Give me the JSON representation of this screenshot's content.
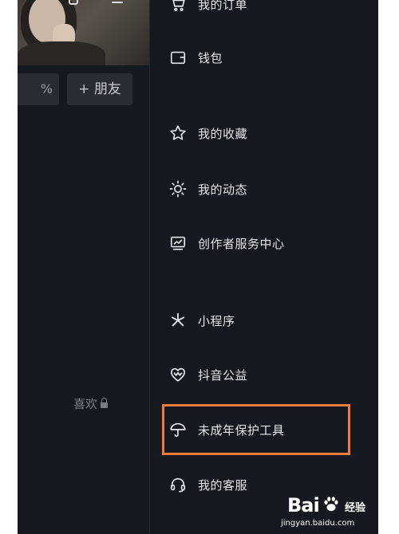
{
  "profile": {
    "partial_button_label": "%",
    "add_friend_label": "+ 朋友",
    "likes_tab_label": "喜欢"
  },
  "drawer": {
    "items": [
      {
        "label": "我的订单",
        "icon": "cart-icon"
      },
      {
        "label": "钱包",
        "icon": "wallet-icon"
      },
      {
        "label": "我的收藏",
        "icon": "star-icon"
      },
      {
        "label": "我的动态",
        "icon": "sun-icon"
      },
      {
        "label": "创作者服务中心",
        "icon": "chart-monitor-icon"
      },
      {
        "label": "小程序",
        "icon": "asterisk-icon"
      },
      {
        "label": "抖音公益",
        "icon": "heart-icon"
      },
      {
        "label": "未成年保护工具",
        "icon": "umbrella-icon"
      },
      {
        "label": "我的客服",
        "icon": "headset-icon"
      }
    ]
  },
  "colors": {
    "background": "#16181f",
    "highlight": "#f07b3d",
    "text": "#e6e7ea"
  },
  "watermark": {
    "brand_part1": "Bai",
    "brand_part2": "经验",
    "url": "jingyan.baidu.com"
  }
}
